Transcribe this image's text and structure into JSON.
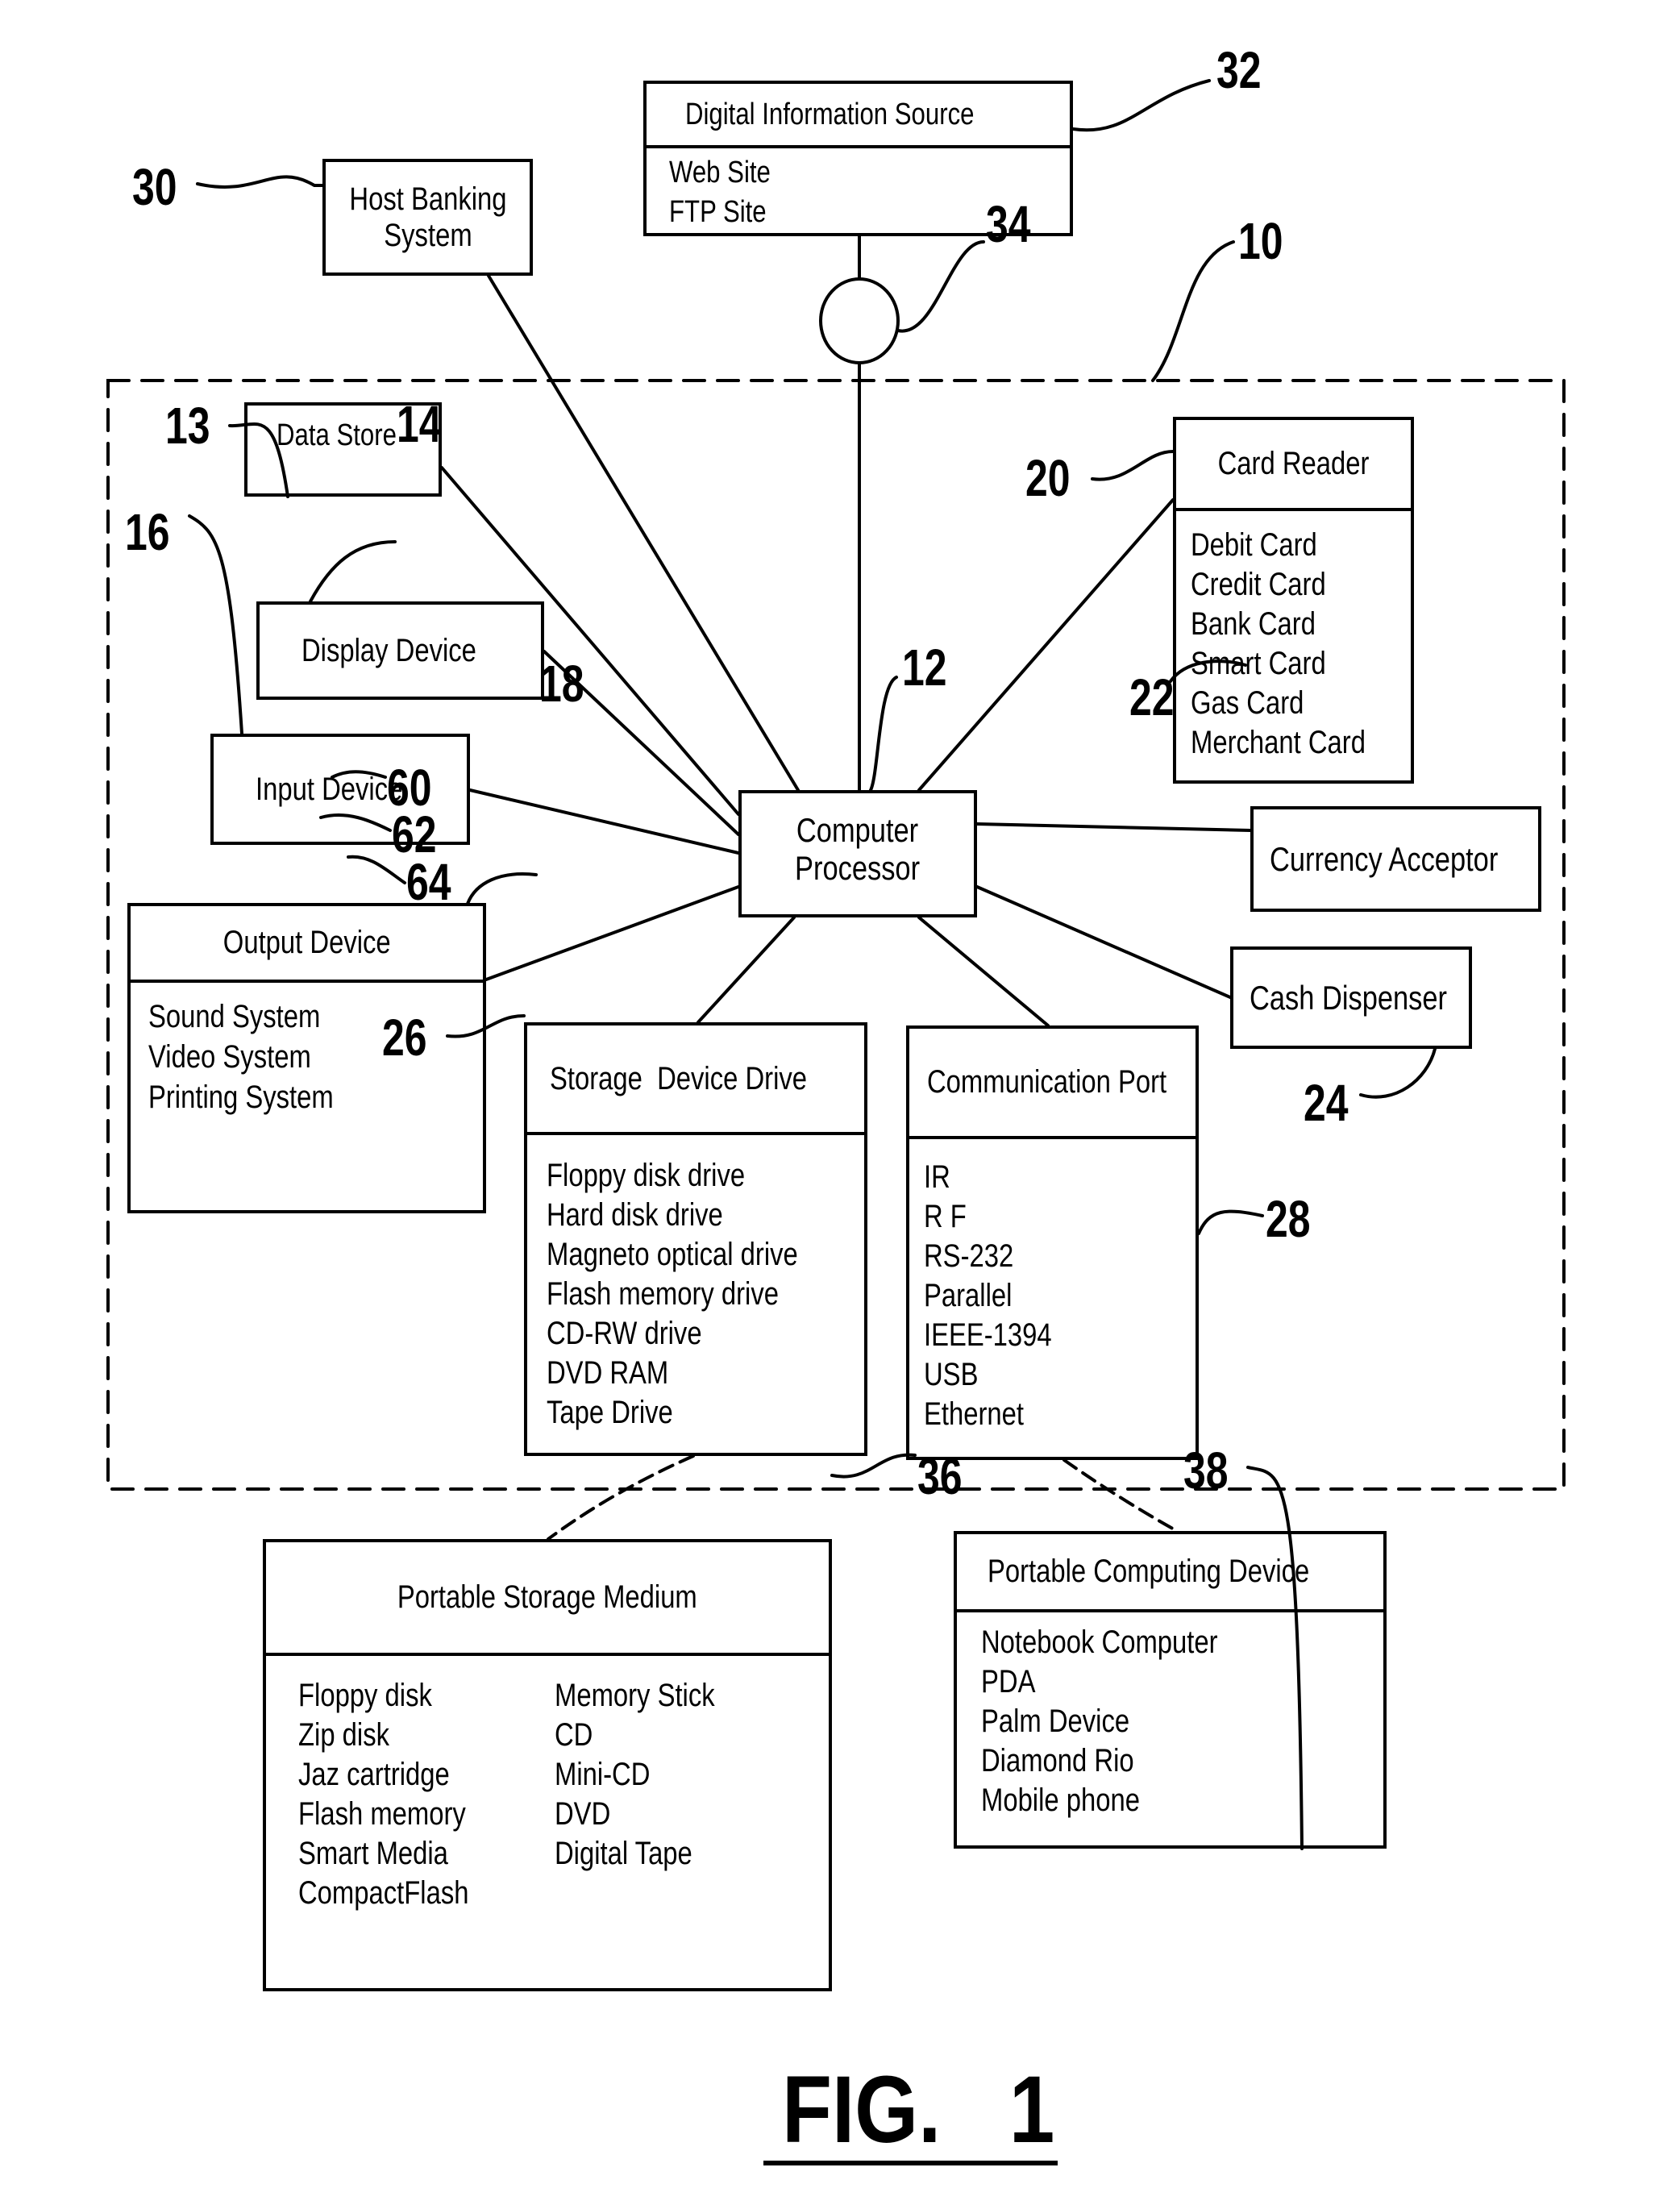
{
  "figure": {
    "caption": "FIG.   1",
    "system_ref": "10"
  },
  "nodes": {
    "digital_source": {
      "title": "Digital Information Source",
      "items": [
        "Web Site",
        "FTP Site"
      ],
      "ref": "32"
    },
    "network_node": {
      "ref": "34"
    },
    "host_banking": {
      "lines": [
        "Host Banking",
        "System"
      ],
      "ref": "30"
    },
    "data_store": {
      "title": "Data Store",
      "ref": "13"
    },
    "display_device": {
      "title": "Display Device",
      "ref": "14"
    },
    "input_device": {
      "title": "Input Device",
      "ref": "16"
    },
    "output_device": {
      "title": "Output Device",
      "ref": "18",
      "items": [
        {
          "label": "Sound System",
          "ref": "60"
        },
        {
          "label": "Video System",
          "ref": "62"
        },
        {
          "label": "Printing System",
          "ref": "64"
        }
      ]
    },
    "processor": {
      "lines": [
        "Computer",
        "Processor"
      ],
      "ref": "12"
    },
    "card_reader": {
      "title": "Card Reader",
      "ref": "20",
      "items": [
        "Debit Card",
        "Credit Card",
        "Bank Card",
        "Smart Card",
        "Gas Card",
        "Merchant Card"
      ]
    },
    "currency_acceptor": {
      "title": "Currency Acceptor",
      "ref": "22"
    },
    "cash_dispenser": {
      "title": "Cash Dispenser",
      "ref": "24"
    },
    "storage_drive": {
      "title": "Storage  Device Drive",
      "ref": "26",
      "items": [
        "Floppy disk drive",
        "Hard disk drive",
        "Magneto optical drive",
        "Flash memory drive",
        "CD-RW drive",
        "DVD RAM",
        "Tape Drive"
      ]
    },
    "comm_port": {
      "title": "Communication Port",
      "ref": "28",
      "items": [
        "IR",
        "R F",
        "RS-232",
        "Parallel",
        "IEEE-1394",
        "USB",
        "Ethernet"
      ]
    },
    "portable_storage": {
      "title": "Portable Storage Medium",
      "ref": "36",
      "col1": [
        "Floppy disk",
        "Zip disk",
        "Jaz cartridge",
        "Flash memory",
        "Smart Media",
        "CompactFlash"
      ],
      "col2": [
        "Memory Stick",
        "CD",
        "Mini-CD",
        "DVD",
        "Digital Tape"
      ]
    },
    "portable_computing": {
      "title": "Portable Computing Device",
      "ref": "38",
      "items": [
        "Notebook Computer",
        "PDA",
        "Palm Device",
        "Diamond Rio",
        "Mobile phone"
      ]
    }
  }
}
